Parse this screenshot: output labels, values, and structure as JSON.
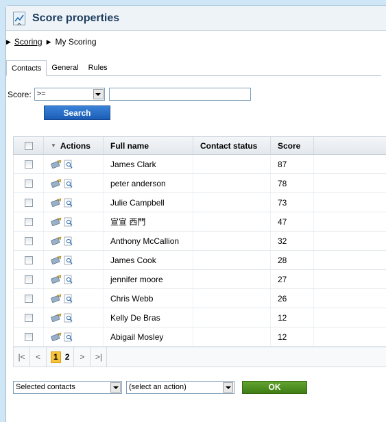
{
  "title": "Score properties",
  "breadcrumb": {
    "parent": "Scoring",
    "current": "My Scoring"
  },
  "tabs": [
    "Contacts",
    "General",
    "Rules"
  ],
  "filter": {
    "label": "Score:",
    "operator": ">=",
    "value": ""
  },
  "search_label": "Search",
  "grid": {
    "actions_label": "Actions",
    "columns": [
      "Full name",
      "Contact status",
      "Score"
    ],
    "rows": [
      {
        "name": "James Clark",
        "status": "",
        "score": "87"
      },
      {
        "name": "peter anderson",
        "status": "",
        "score": "78"
      },
      {
        "name": "Julie Campbell",
        "status": "",
        "score": "73"
      },
      {
        "name": "宣宣 西門",
        "status": "",
        "score": "47"
      },
      {
        "name": "Anthony McCallion",
        "status": "",
        "score": "32"
      },
      {
        "name": "James Cook",
        "status": "",
        "score": "28"
      },
      {
        "name": "jennifer moore",
        "status": "",
        "score": "27"
      },
      {
        "name": "Chris Webb",
        "status": "",
        "score": "26"
      },
      {
        "name": "Kelly De Bras",
        "status": "",
        "score": "12"
      },
      {
        "name": "Abigail Mosley",
        "status": "",
        "score": "12"
      }
    ]
  },
  "pager": {
    "current": "1",
    "next": "2"
  },
  "bottom": {
    "scope": "Selected contacts",
    "action": "(select an action)",
    "ok": "OK"
  },
  "colors": {
    "search_button": "#1c5db5",
    "ok_button": "#3e7d15",
    "current_page": "#f7c33b"
  }
}
